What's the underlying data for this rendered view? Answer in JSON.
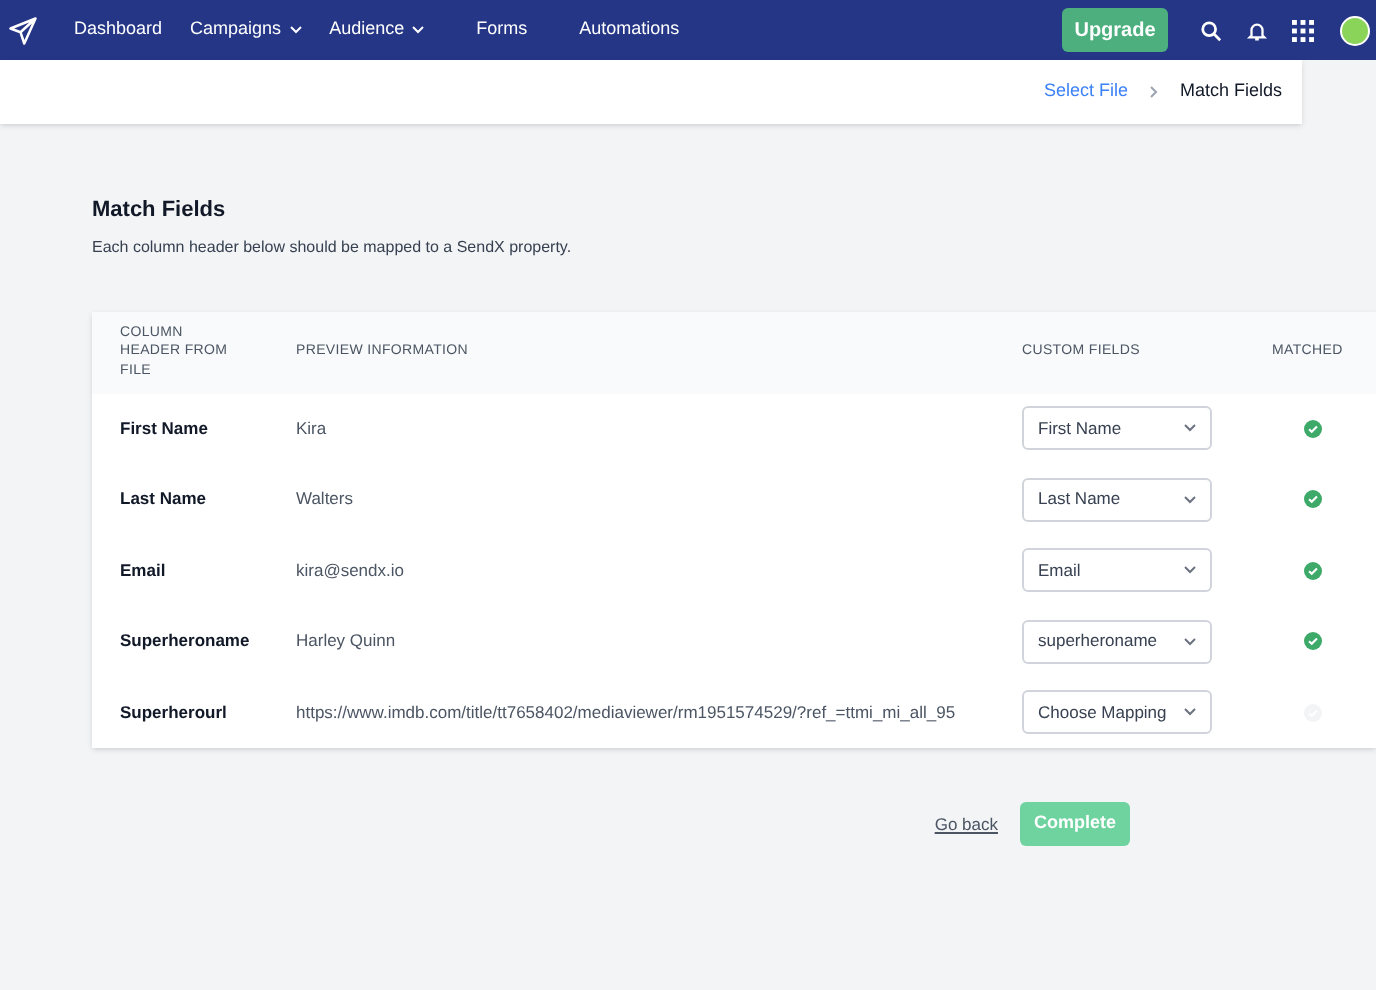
{
  "nav": {
    "items": [
      {
        "label": "Dashboard",
        "dropdown": false
      },
      {
        "label": "Campaigns",
        "dropdown": true
      },
      {
        "label": "Audience",
        "dropdown": true
      },
      {
        "label": "Forms",
        "dropdown": false
      },
      {
        "label": "Automations",
        "dropdown": false
      }
    ],
    "upgrade": "Upgrade"
  },
  "breadcrumb": [
    {
      "label": "Select File",
      "selected": false
    },
    {
      "label": "Match Fields",
      "selected": true
    }
  ],
  "heading": "Match Fields",
  "description": "Each column header below should be mapped to a SendX property.",
  "table": {
    "columns": [
      "COLUMN HEADER FROM FILE",
      "PREVIEW INFORMATION",
      "CUSTOM FIELDS",
      "MATCHED"
    ],
    "rows": [
      {
        "header": "First Name",
        "preview": "Kira",
        "field": "First Name",
        "matched": true
      },
      {
        "header": "Last Name",
        "preview": "Walters",
        "field": "Last Name",
        "matched": true
      },
      {
        "header": "Email",
        "preview": "kira@sendx.io",
        "field": "Email",
        "matched": true
      },
      {
        "header": "Superheroname",
        "preview": "Harley Quinn",
        "field": "superheroname",
        "matched": true
      },
      {
        "header": "Superherourl",
        "preview": "https://www.imdb.com/title/tt7658402/mediaviewer/rm1951574529/?ref_=ttmi_mi_all_95",
        "field": "Choose Mapping",
        "matched": false
      }
    ]
  },
  "actions": {
    "back": "Go back",
    "complete": "Complete"
  }
}
